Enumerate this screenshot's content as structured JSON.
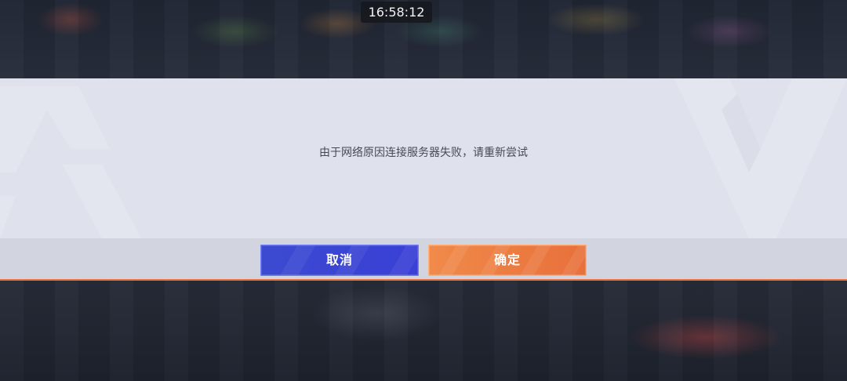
{
  "status_bar": {
    "clock": "16:58:12"
  },
  "dialog": {
    "message": "由于网络原因连接服务器失败，请重新尝试",
    "cancel_label": "取消",
    "confirm_label": "确定"
  },
  "colors": {
    "dialog_background": "#dfe2ec",
    "footer_background": "#d2d5df",
    "cancel_button": "#3a43d4",
    "confirm_button": "#ec7a40",
    "accent_line": "#e8763a"
  }
}
